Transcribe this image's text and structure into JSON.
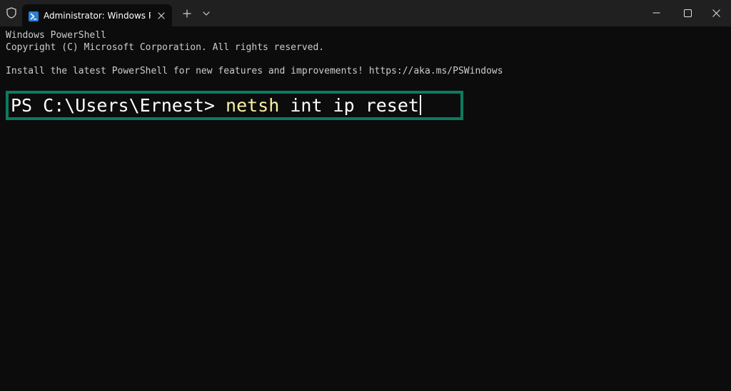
{
  "window": {
    "tab_title": "Administrator: Windows PowerShell",
    "new_tab_label": "+",
    "icons": {
      "admin": "shield-icon",
      "tab": "powershell-icon",
      "tab_close": "close-icon",
      "dropdown": "chevron-down-icon",
      "minimize": "minimize-icon",
      "maximize": "maximize-icon",
      "close": "close-icon"
    }
  },
  "terminal": {
    "lines": [
      "Windows PowerShell",
      "Copyright (C) Microsoft Corporation. All rights reserved.",
      "Install the latest PowerShell for new features and improvements! https://aka.ms/PSWindows"
    ],
    "prompt": "PS C:\\Users\\Ernest> ",
    "command": "netsh",
    "args": " int ip reset"
  },
  "colors": {
    "background": "#0c0c0c",
    "titlebar": "#202020",
    "text": "#cccccc",
    "command": "#f9f1a5",
    "highlight_border": "#0e7a5f"
  }
}
